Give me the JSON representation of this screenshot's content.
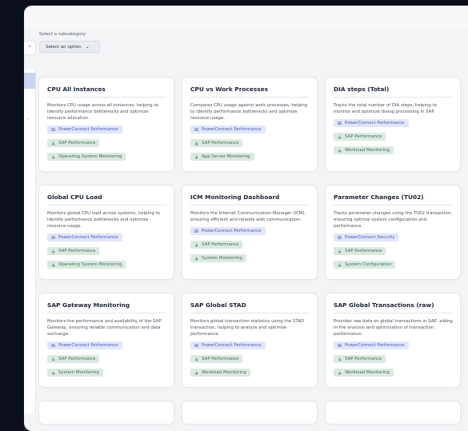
{
  "filter": {
    "label": "Select a subcategory",
    "select_value": "Select an option"
  },
  "cards": [
    {
      "title": "CPU All Instances",
      "desc": "Monitors CPU usage across all instances, helping to identify performance bottlenecks and optimize resource allocation.",
      "tags": [
        {
          "label": "PowerConnect Performance",
          "type": "blue"
        },
        {
          "label": "SAP Performance",
          "type": "green"
        },
        {
          "label": "Operating System Monitoring",
          "type": "green"
        }
      ]
    },
    {
      "title": "CPU vs Work Processes",
      "desc": "Compares CPU usage against work processes, helping to identify performance bottlenecks and optimize resource usage.",
      "tags": [
        {
          "label": "PowerConnect Performance",
          "type": "blue"
        },
        {
          "label": "SAP Performance",
          "type": "green"
        },
        {
          "label": "App Server Monitoring",
          "type": "green"
        }
      ]
    },
    {
      "title": "DIA steps (Total)",
      "desc": "Tracks the total number of DIA steps, helping to monitor and optimize dialog processing in SAP.",
      "tags": [
        {
          "label": "PowerConnect Performance",
          "type": "blue"
        },
        {
          "label": "SAP Performance",
          "type": "green"
        },
        {
          "label": "Workload Monitoring",
          "type": "green"
        }
      ]
    },
    {
      "title": "Global CPU Load",
      "desc": "Monitors global CPU load across systems, helping to identify performance bottlenecks and optimize resource usage.",
      "tags": [
        {
          "label": "PowerConnect Performance",
          "type": "blue"
        },
        {
          "label": "SAP Performance",
          "type": "green"
        },
        {
          "label": "Operating System Monitoring",
          "type": "green"
        }
      ]
    },
    {
      "title": "ICM Monitoring Dashboard",
      "desc": "Monitors the Internet Communication Manager (ICM), ensuring efficient and reliable web communication.",
      "tags": [
        {
          "label": "PowerConnect Performance",
          "type": "blue"
        },
        {
          "label": "SAP Performance",
          "type": "green"
        },
        {
          "label": "System Monitoring",
          "type": "green"
        }
      ]
    },
    {
      "title": "Parameter Changes (TU02)",
      "desc": "Tracks parameter changes using the TU02 transaction, ensuring optimal system configuration and performance.",
      "tags": [
        {
          "label": "PowerConnect Security",
          "type": "blue"
        },
        {
          "label": "SAP Performance",
          "type": "green"
        },
        {
          "label": "System Configuration",
          "type": "green"
        }
      ]
    },
    {
      "title": "SAP Gateway Monitoring",
      "desc": "Monitors the performance and availability of the SAP Gateway, ensuring reliable communication and data exchange.",
      "tags": [
        {
          "label": "PowerConnect Performance",
          "type": "blue"
        },
        {
          "label": "SAP Performance",
          "type": "green"
        },
        {
          "label": "System Monitoring",
          "type": "green"
        }
      ]
    },
    {
      "title": "SAP Global STAD",
      "desc": "Monitors global transaction statistics using the STAD transaction, helping to analyze and optimize performance.",
      "tags": [
        {
          "label": "PowerConnect Performance",
          "type": "blue"
        },
        {
          "label": "SAP Performance",
          "type": "green"
        },
        {
          "label": "Workload Monitoring",
          "type": "green"
        }
      ]
    },
    {
      "title": "SAP Global Transactions (raw)",
      "desc": "Provides raw data on global transactions in SAP, aiding in the analysis and optimization of transaction performance.",
      "tags": [
        {
          "label": "PowerConnect Performance",
          "type": "blue"
        },
        {
          "label": "SAP Performance",
          "type": "green"
        },
        {
          "label": "Workload Monitoring",
          "type": "green"
        }
      ]
    }
  ],
  "icons": {
    "blue": "grid-icon",
    "green": "hierarchy-icon"
  }
}
